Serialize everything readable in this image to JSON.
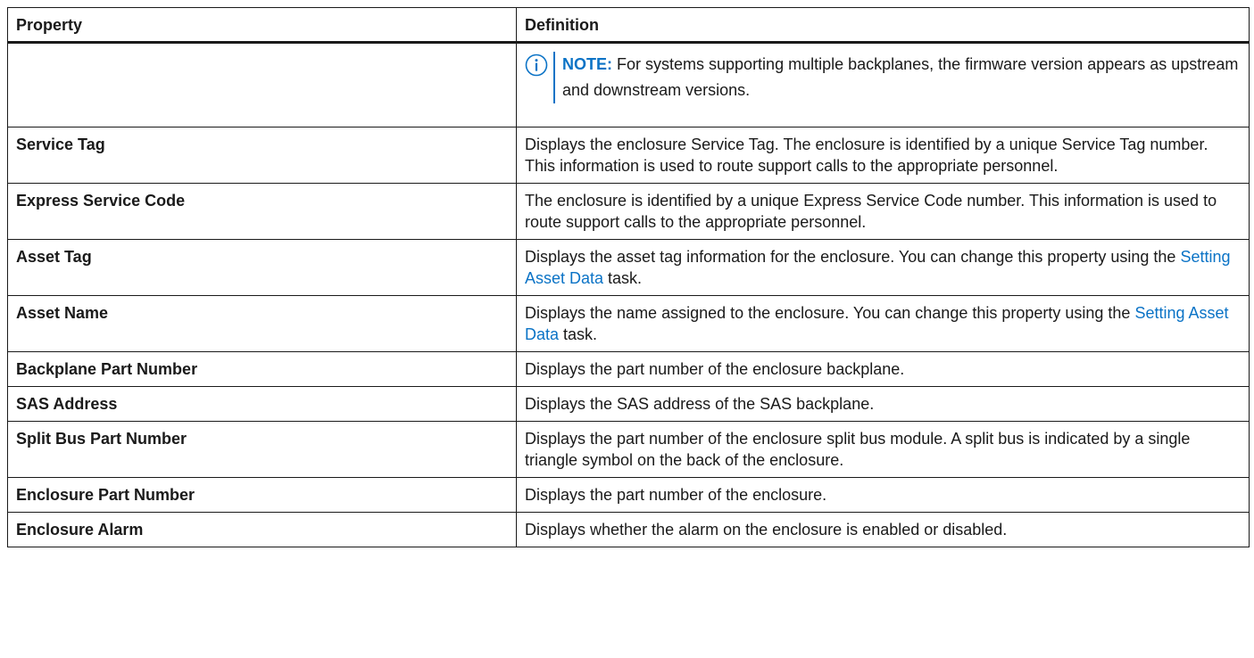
{
  "table": {
    "headers": {
      "property": "Property",
      "definition": "Definition"
    },
    "note_row": {
      "property": "",
      "note_label": "NOTE:",
      "note_text": "For systems supporting multiple backplanes, the firmware version appears as upstream and downstream versions.",
      "icon": "info-icon"
    },
    "rows": [
      {
        "property": "Service Tag",
        "definition": "Displays the enclosure Service Tag. The enclosure is identified by a unique Service Tag number. This information is used to route support calls to the appropriate personnel."
      },
      {
        "property": "Express Service Code",
        "definition": "The enclosure is identified by a unique Express Service Code number. This information is used to route support calls to the appropriate personnel."
      },
      {
        "property": "Asset Tag",
        "definition_before": "Displays the asset tag information for the enclosure. You can change this property using the ",
        "definition_link": "Setting Asset Data",
        "definition_after": " task."
      },
      {
        "property": "Asset Name",
        "definition_before": "Displays the name assigned to the enclosure. You can change this property using the ",
        "definition_link": "Setting Asset Data",
        "definition_after": " task."
      },
      {
        "property": "Backplane Part Number",
        "definition": "Displays the part number of the enclosure backplane."
      },
      {
        "property": "SAS Address",
        "definition": "Displays the SAS address of the SAS backplane."
      },
      {
        "property": "Split Bus Part Number",
        "definition": "Displays the part number of the enclosure split bus module. A split bus is indicated by a single triangle symbol on the back of the enclosure."
      },
      {
        "property": "Enclosure Part Number",
        "definition": "Displays the part number of the enclosure."
      },
      {
        "property": "Enclosure Alarm",
        "definition": "Displays whether the alarm on the enclosure is enabled or disabled."
      }
    ]
  },
  "colors": {
    "accent": "#0b73c6",
    "text": "#1a1a1a",
    "border": "#1a1a1a"
  }
}
